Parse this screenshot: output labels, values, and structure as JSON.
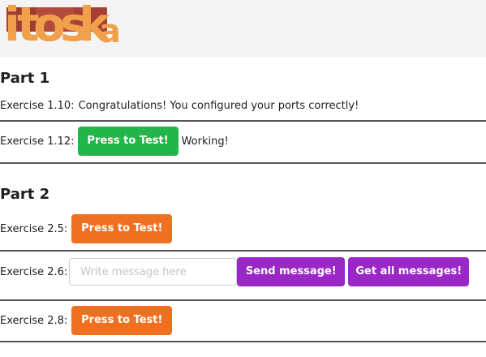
{
  "logo": {
    "text": "itoska",
    "colors": {
      "block_dark": "#9e3b33",
      "block_mid": "#b44a3a",
      "letters": "#f0a04b"
    }
  },
  "part1": {
    "heading": "Part 1",
    "ex110": {
      "label": "Exercise 1.10:",
      "message": "Congratulations! You configured your ports correctly!"
    },
    "ex112": {
      "label": "Exercise 1.12:",
      "button": "Press to Test!",
      "status": "Working!"
    }
  },
  "part2": {
    "heading": "Part 2",
    "ex25": {
      "label": "Exercise 2.5:",
      "button": "Press to Test!"
    },
    "ex26": {
      "label": "Exercise 2.6:",
      "input_placeholder": "Write message here",
      "input_value": "",
      "send_button": "Send message!",
      "get_button": "Get all messages!"
    },
    "ex28": {
      "label": "Exercise 2.8:",
      "button": "Press to Test!"
    }
  },
  "colors": {
    "green": "#22b54a",
    "orange": "#f07021",
    "purple": "#9a28c6",
    "divider": "#555555"
  }
}
